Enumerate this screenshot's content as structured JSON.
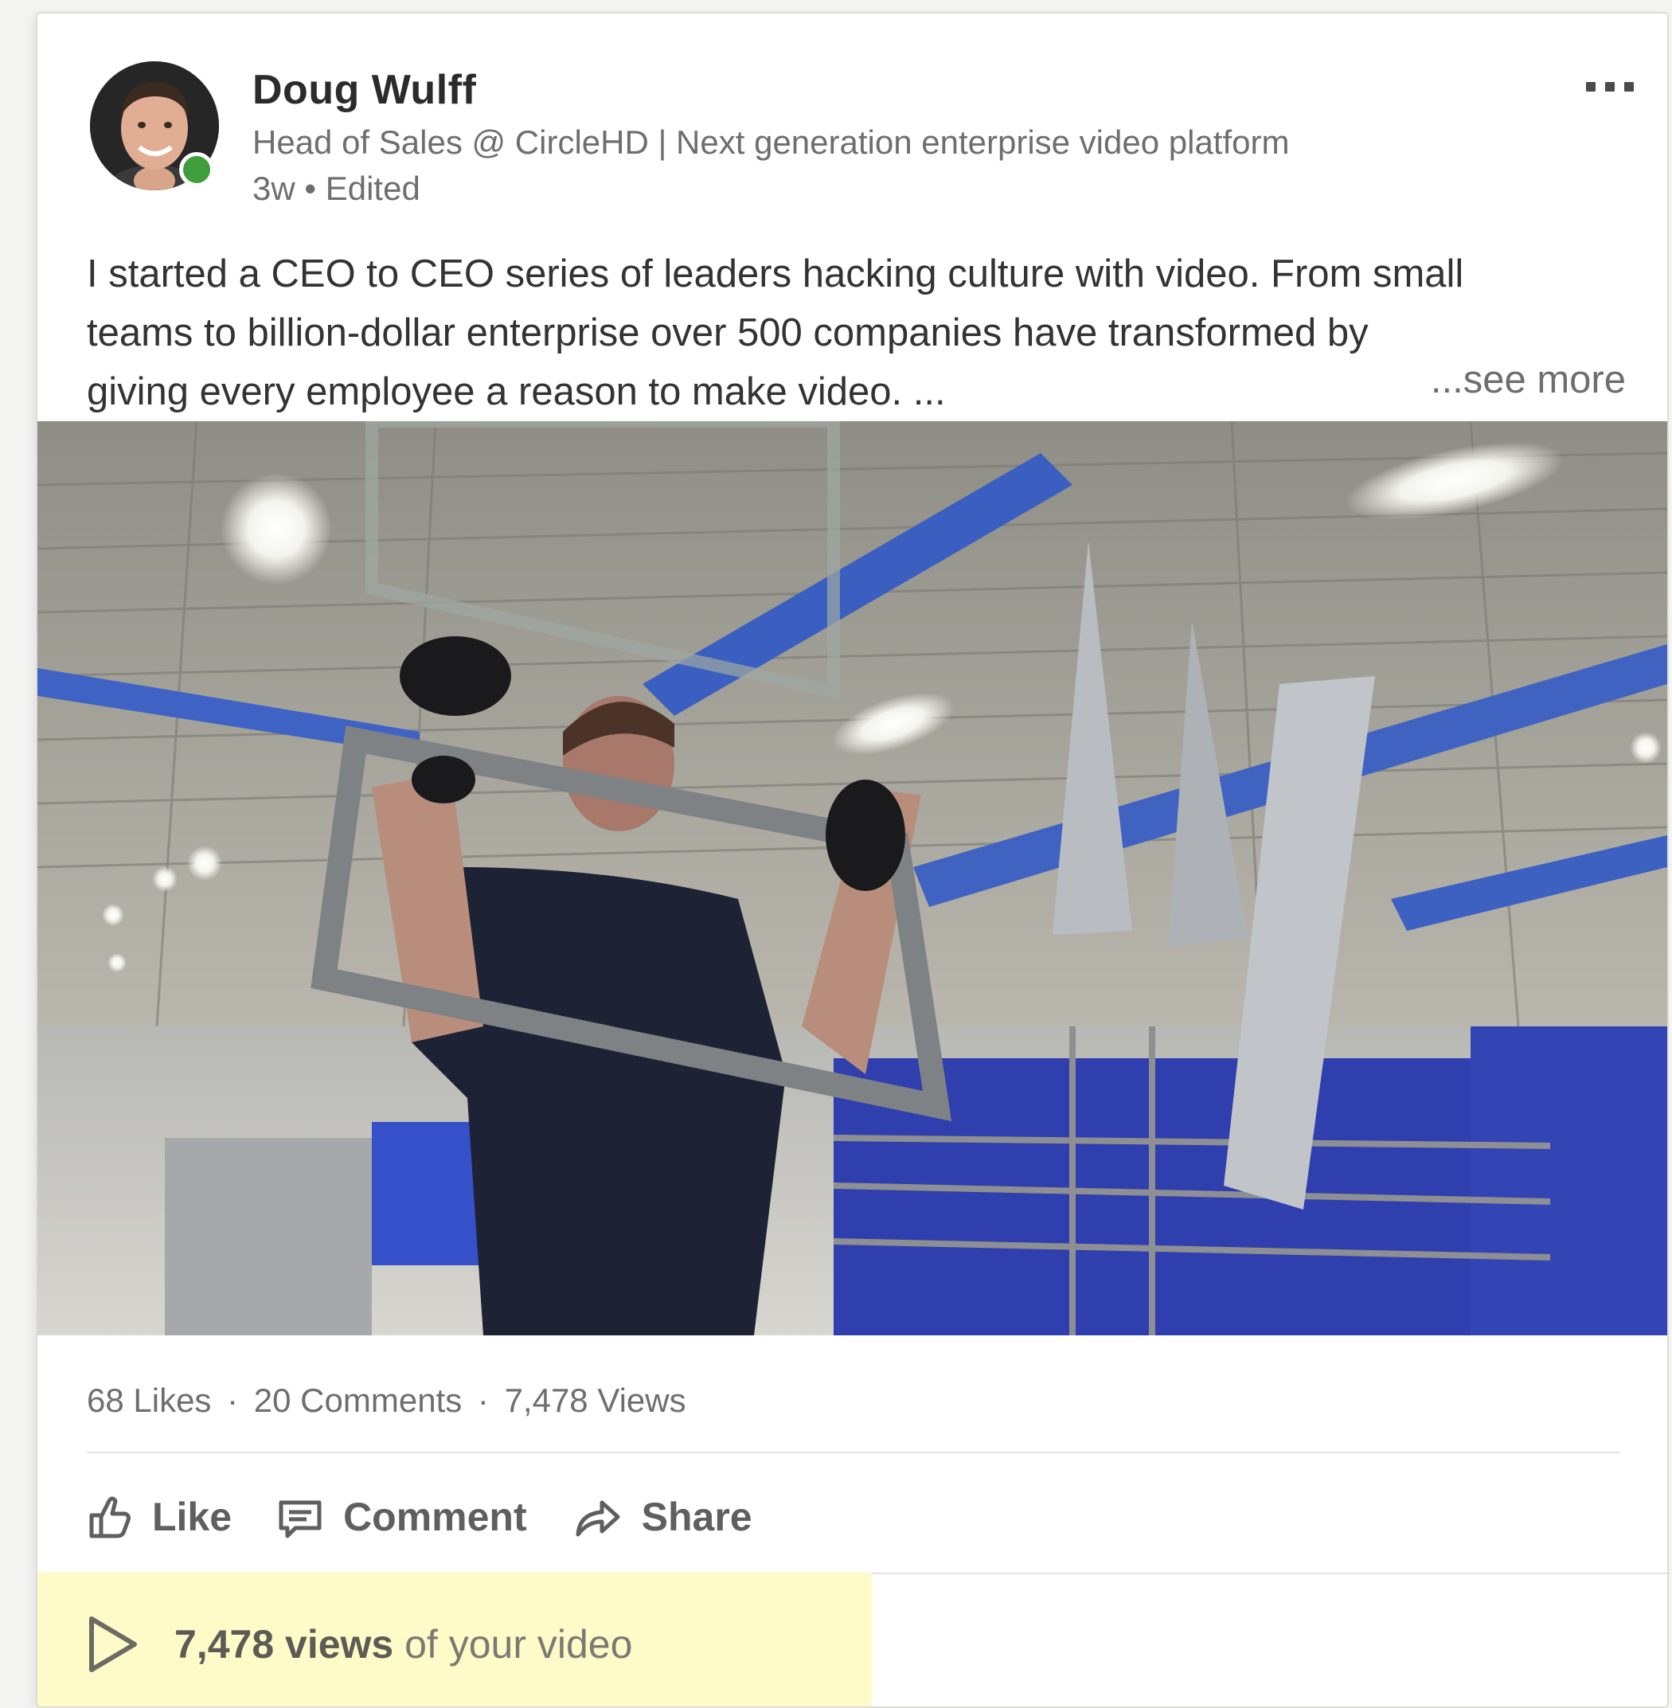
{
  "author": {
    "name": "Doug Wulff",
    "headline": "Head of Sales @ CircleHD | Next generation enterprise video platform",
    "meta": "3w • Edited",
    "online": true
  },
  "post": {
    "text_lines": [
      "I started a CEO to CEO series of leaders hacking culture with video. From small",
      "teams to billion-dollar enterprise over 500 companies have transformed by",
      "giving every employee a reason to make video. ..."
    ],
    "see_more": "...see more"
  },
  "stats": {
    "likes": "68 Likes",
    "comments": "20 Comments",
    "views": "7,478 Views",
    "separator": "·"
  },
  "actions": {
    "like": "Like",
    "comment": "Comment",
    "share": "Share"
  },
  "views_banner": {
    "count": "7,478 views",
    "suffix": " of your video"
  },
  "icons": {
    "like": "thumbs-up-icon",
    "comment": "comment-icon",
    "share": "share-arrow-icon",
    "play": "play-icon",
    "more": "more-dots-icon"
  },
  "colors": {
    "banner_background": "#fffbc9",
    "presence": "#3f9e3b",
    "text": "#333333",
    "muted": "#6e6e6e"
  }
}
